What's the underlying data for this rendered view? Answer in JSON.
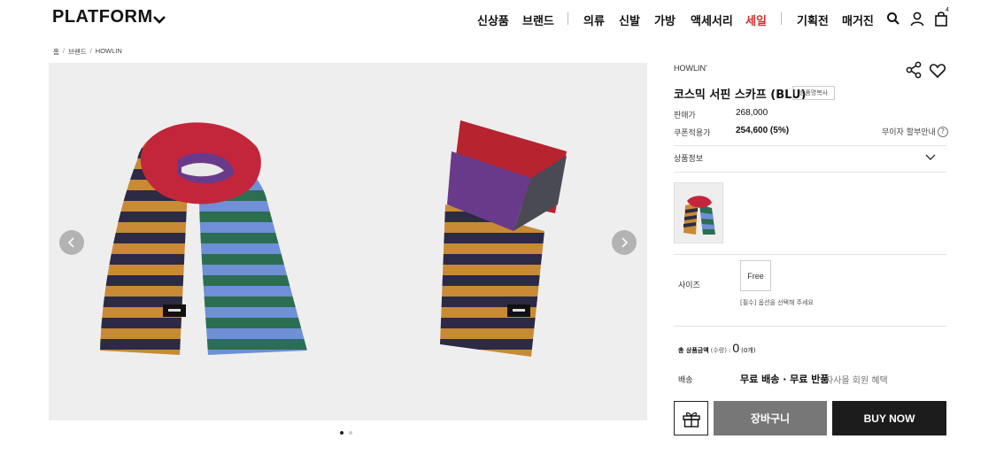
{
  "header": {
    "logo": "PLATFORM",
    "nav_primary": [
      "신상품",
      "브랜드"
    ],
    "nav_categories": [
      "의류",
      "신발",
      "가방",
      "액세서리",
      "세일"
    ],
    "nav_secondary": [
      "기획전",
      "매거진"
    ],
    "cart_count": "4",
    "sale_color": "#d62b2b"
  },
  "breadcrumb": {
    "items": [
      "홈",
      "브랜드",
      "HOWLIN"
    ],
    "separator": "/"
  },
  "gallery": {
    "images": [
      "scarf-flat-view",
      "scarf-folded-view"
    ],
    "dots": 2,
    "active_dot": 0
  },
  "product": {
    "brand": "HOWLIN'",
    "title": "코스믹 서핀 스카프 (BLU)",
    "copy_button": "상품명복사",
    "price_label": "판매가",
    "price_value": "268,000",
    "coupon_label": "쿠폰적용가",
    "coupon_value": "254,600 (5%)",
    "installment_label": "무이자 할부안내",
    "info_label": "상품정보"
  },
  "options": {
    "size_label": "사이즈",
    "size_values": [
      "Free"
    ],
    "hint": "[필수] 옵션을 선택해 주세요"
  },
  "summary": {
    "total_label": "총 상품금액",
    "quantity_label": "(수량)",
    "total_separator": ":",
    "total_value": "0",
    "total_count": "(0개)",
    "shipping_label": "배송",
    "shipping_value": "무료 배송 · 무료 반품",
    "shipping_note": "자사몰 회원 혜택"
  },
  "actions": {
    "cart_label": "장바구니",
    "buy_label": "BUY NOW"
  }
}
